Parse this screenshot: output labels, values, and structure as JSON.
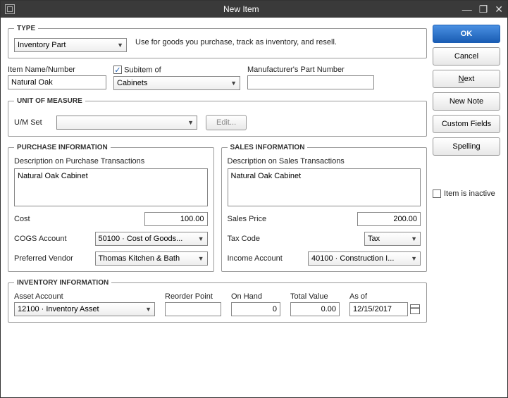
{
  "title": "New Item",
  "buttons": {
    "ok": "OK",
    "cancel": "Cancel",
    "next": "ext",
    "next_prefix": "N",
    "newnote": "New Note",
    "custom": "Custom Fields",
    "spelling": "Spellin",
    "spelling_suffix": "g"
  },
  "type": {
    "legend": "TYPE",
    "value": "Inventory Part",
    "desc": "Use for goods you purchase, track as inventory, and resell."
  },
  "itemname": {
    "label": "Item Name/Number",
    "value": "Natural Oak"
  },
  "subitem": {
    "label": "Subitem of",
    "checked": "✓",
    "value": "Cabinets"
  },
  "mpn": {
    "label": "Manufacturer's Part Number",
    "value": ""
  },
  "uom": {
    "legend": "UNIT OF MEASURE",
    "label": "U/M Set",
    "value": "",
    "edit": "Edit..."
  },
  "purchase": {
    "legend": "PURCHASE INFORMATION",
    "desc_label": "Description on Purchase Transactions",
    "desc": "Natural Oak Cabinet",
    "cost_label": "Cost",
    "cost": "100.00",
    "cogs_label": "COGS Account",
    "cogs": "50100 · Cost of Goods...",
    "vendor_label": "Preferred Vendor",
    "vendor": "Thomas Kitchen & Bath"
  },
  "sales": {
    "legend": "SALES INFORMATION",
    "desc_label": "Description on Sales Transactions",
    "desc": "Natural Oak Cabinet",
    "price_label": "Sales Price",
    "price": "200.00",
    "tax_label": "Tax Code",
    "tax": "Tax",
    "income_label": "Income Account",
    "income": "40100 · Construction I..."
  },
  "inactive": "Item is inactive",
  "inventory": {
    "legend": "INVENTORY INFORMATION",
    "asset_label": "Asset Account",
    "asset": "12100 · Inventory Asset",
    "reorder_label": "Reorder Point",
    "reorder": "",
    "onhand_label": "On Hand",
    "onhand": "0",
    "total_label": "Total Value",
    "total": "0.00",
    "asof_label": "As of",
    "asof": "12/15/2017"
  }
}
